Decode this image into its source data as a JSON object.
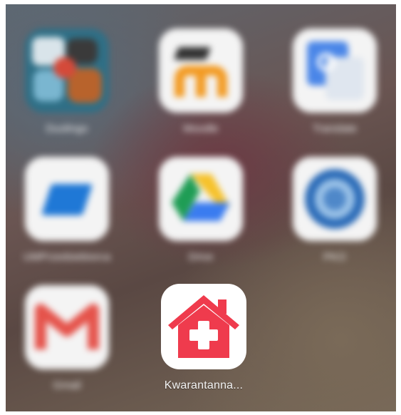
{
  "folder": {
    "apps": [
      {
        "label": "Duolingo",
        "icon": "colorful-game-icon"
      },
      {
        "label": "Moodle",
        "icon": "moodle-m-icon"
      },
      {
        "label": "Translate",
        "icon": "translate-icon"
      },
      {
        "label": "UMPrzedsiebiorca",
        "icon": "blue-parallelogram-icon"
      },
      {
        "label": "Drive",
        "icon": "drive-triangle-icon"
      },
      {
        "label": "PKO",
        "icon": "round-globe-icon"
      },
      {
        "label": "Gmail",
        "icon": "gmail-m-icon"
      },
      {
        "label": "Kwarantanna...",
        "icon": "house-cross-icon"
      }
    ]
  },
  "colors": {
    "house_red": "#ef3b4d",
    "drive_yellow": "#f6c22b",
    "drive_green": "#1f9d55",
    "drive_blue": "#3a7cf0",
    "gmail_red": "#e5534b",
    "moodle_orange": "#f39a21"
  }
}
